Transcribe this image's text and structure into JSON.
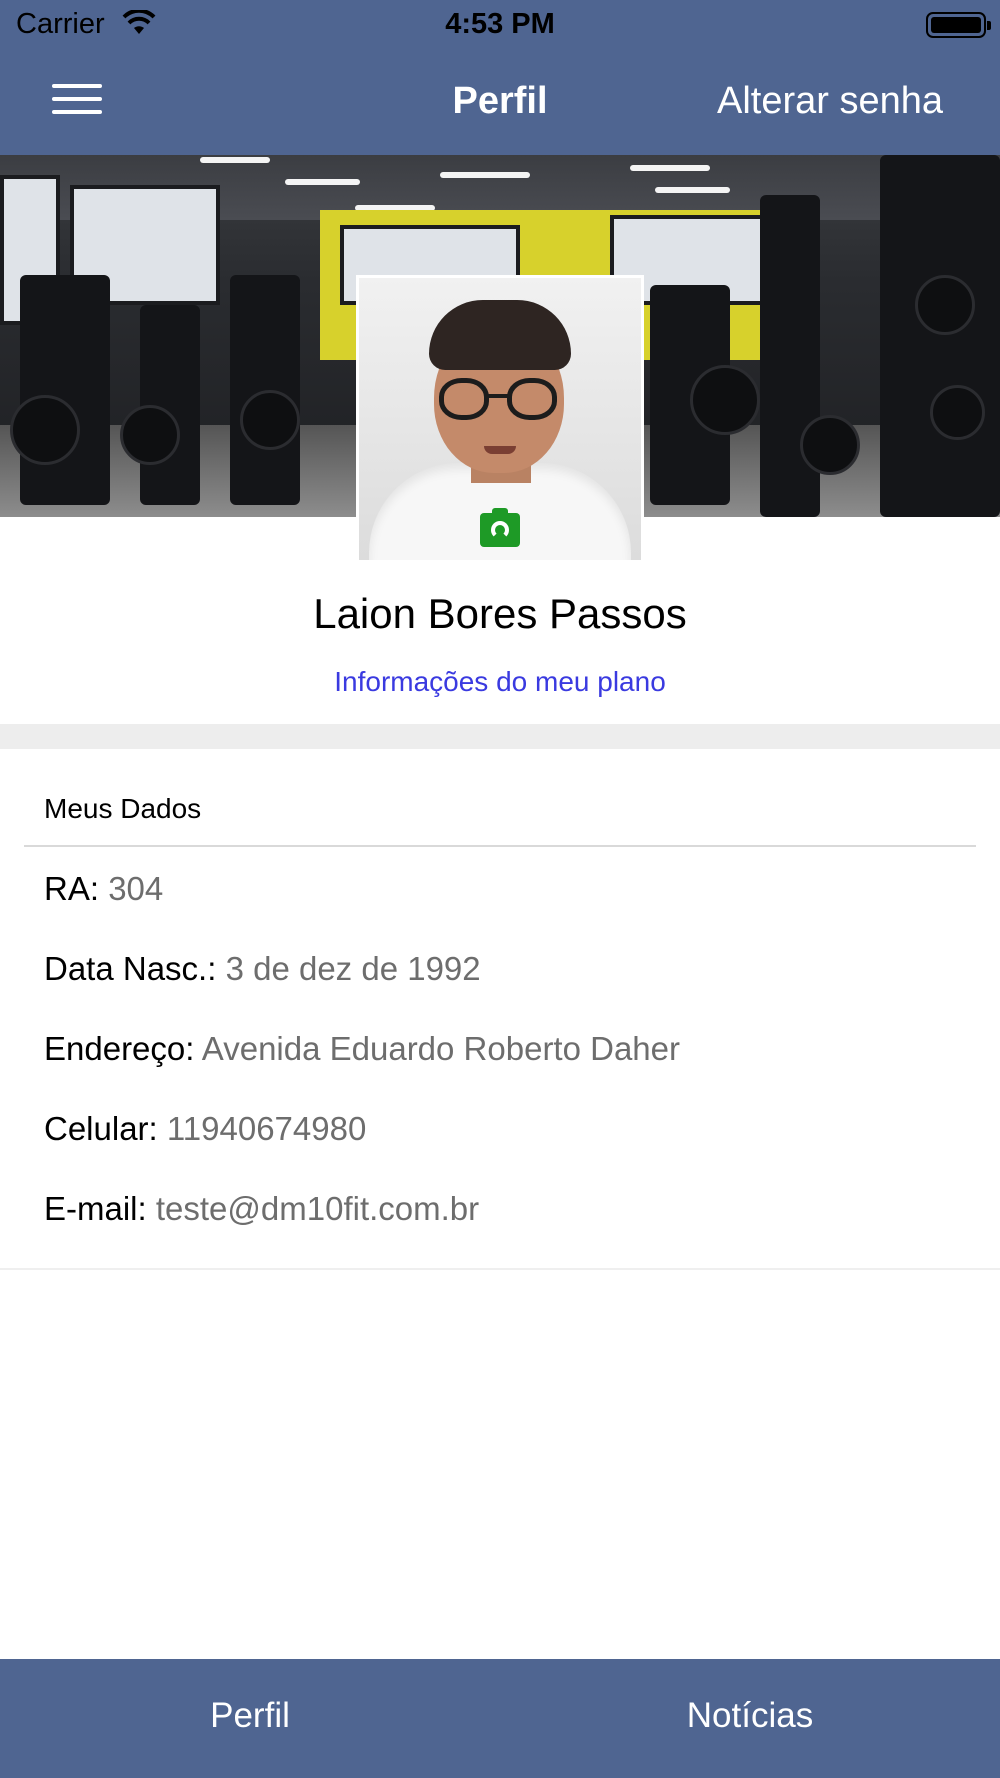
{
  "status_bar": {
    "carrier": "Carrier",
    "time": "4:53 PM"
  },
  "nav": {
    "title": "Perfil",
    "right_action": "Alterar senha"
  },
  "profile": {
    "name": "Laion Bores Passos",
    "plan_link": "Informações do meu plano"
  },
  "details": {
    "section_title": "Meus Dados",
    "rows": [
      {
        "label": "RA:",
        "value": "304"
      },
      {
        "label": "Data Nasc.:",
        "value": "3 de dez de 1992"
      },
      {
        "label": "Endereço:",
        "value": "Avenida Eduardo Roberto Daher"
      },
      {
        "label": "Celular:",
        "value": "11940674980"
      },
      {
        "label": "E-mail:",
        "value": "teste@dm10fit.com.br"
      }
    ]
  },
  "tabs": [
    {
      "label": "Perfil"
    },
    {
      "label": "Notícias"
    }
  ],
  "colors": {
    "bar": "#4f6591",
    "link": "#3a3ae0",
    "camera": "#1e9a26"
  },
  "icons": {
    "menu": "hamburger-menu-icon",
    "camera": "camera-icon",
    "wifi": "wifi-icon",
    "battery": "battery-icon"
  }
}
